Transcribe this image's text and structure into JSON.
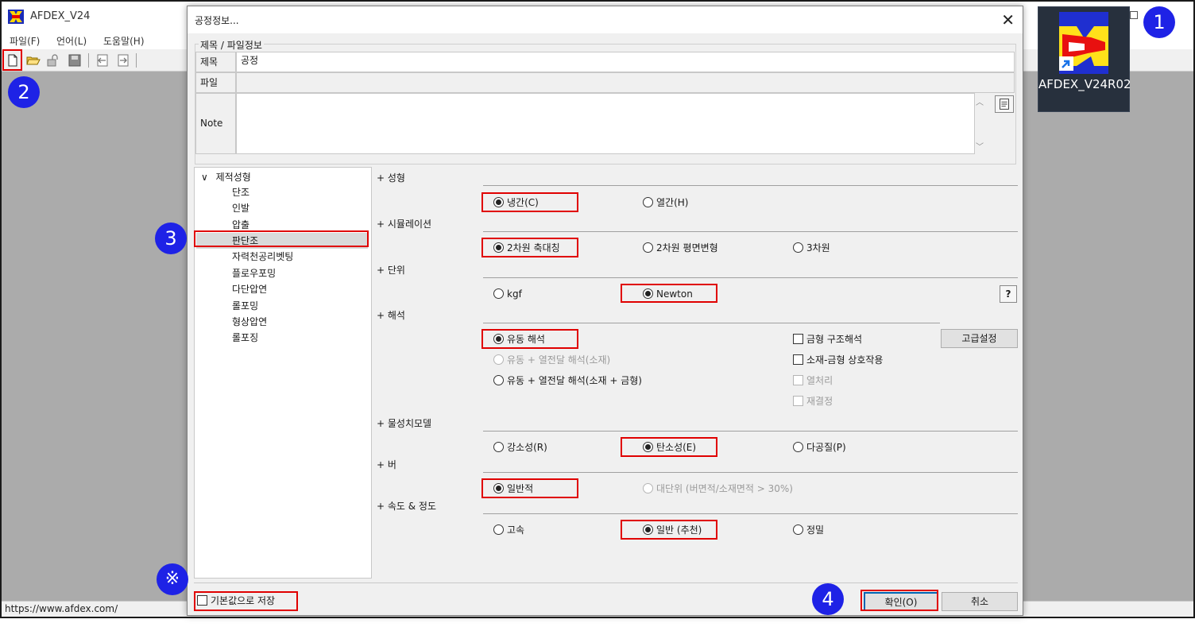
{
  "app": {
    "title": "AFDEX_V24",
    "menu": [
      "파일(F)",
      "언어(L)",
      "도움말(H)"
    ],
    "status_url": "https://www.afdex.com/"
  },
  "shortcut": {
    "label": "AFDEX_V24R02"
  },
  "badges": [
    "1",
    "2",
    "3",
    "4",
    "※"
  ],
  "dialog": {
    "title": "공정정보...",
    "file_group_title": "제목 / 파일정보",
    "title_label": "제목",
    "title_value": "공정",
    "file_label": "파일",
    "file_value": "",
    "note_label": "Note",
    "note_value": ""
  },
  "tree": {
    "root": "제적성형",
    "items": [
      "단조",
      "인발",
      "압출",
      "판단조",
      "자력천공리벳팅",
      "플로우포밍",
      "다단압연",
      "롤포밍",
      "형상압연",
      "롤포징"
    ],
    "selected": "판단조"
  },
  "sections": {
    "forming": {
      "label": "+ 성형",
      "options": [
        {
          "label": "냉간(C)",
          "selected": true
        },
        {
          "label": "열간(H)",
          "selected": false
        }
      ]
    },
    "simulation": {
      "label": "+ 시뮬레이션",
      "options": [
        {
          "label": "2차원 축대칭",
          "selected": true
        },
        {
          "label": "2차원 평면변형",
          "selected": false
        },
        {
          "label": "3차원",
          "selected": false
        }
      ]
    },
    "unit": {
      "label": "+ 단위",
      "options": [
        {
          "label": "kgf",
          "selected": false
        },
        {
          "label": "Newton",
          "selected": true
        }
      ],
      "help_label": "?"
    },
    "analysis": {
      "label": "+ 해석",
      "options": [
        {
          "label": "유동 해석",
          "selected": true
        },
        {
          "label": "유동 + 열전달 해석(소재)",
          "selected": false,
          "disabled": true
        },
        {
          "label": "유동 + 열전달 해석(소재 + 금형)",
          "selected": false
        }
      ],
      "checks": [
        {
          "label": "금형 구조해석",
          "checked": false
        },
        {
          "label": "소재-금형 상호작용",
          "checked": false
        },
        {
          "label": "열처리",
          "checked": false,
          "disabled": true
        },
        {
          "label": "재결정",
          "checked": false,
          "disabled": true
        }
      ],
      "advanced_label": "고급설정"
    },
    "material": {
      "label": "+ 물성치모델",
      "options": [
        {
          "label": "강소성(R)",
          "selected": false
        },
        {
          "label": "탄소성(E)",
          "selected": true
        },
        {
          "label": "다공질(P)",
          "selected": false
        }
      ]
    },
    "burr": {
      "label": "+ 버",
      "options": [
        {
          "label": "일반적",
          "selected": true
        },
        {
          "label": "대단위 (버면적/소재면적 > 30%)",
          "selected": false,
          "disabled": true
        }
      ]
    },
    "speed": {
      "label": "+ 속도 & 정도",
      "options": [
        {
          "label": "고속",
          "selected": false
        },
        {
          "label": "일반 (추천)",
          "selected": true
        },
        {
          "label": "정밀",
          "selected": false
        }
      ]
    }
  },
  "footer": {
    "save_default": "기본값으로 저장",
    "ok": "확인(O)",
    "cancel": "취소"
  },
  "colors": {
    "badge": "#1e22e6",
    "highlight": "#e00000",
    "app_bg": "#ababab"
  }
}
